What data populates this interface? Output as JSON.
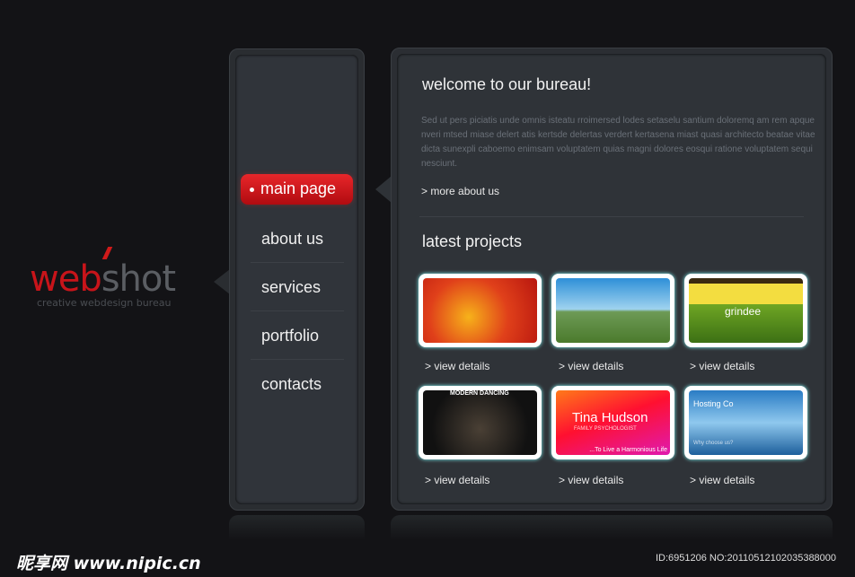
{
  "logo": {
    "part1": "web",
    "part2": "shot",
    "tagline": "creative webdesign bureau"
  },
  "nav": {
    "items": [
      {
        "label": "main page",
        "active": true
      },
      {
        "label": "about us"
      },
      {
        "label": "services"
      },
      {
        "label": "portfolio"
      },
      {
        "label": "contacts"
      }
    ]
  },
  "welcome": {
    "title": "welcome to our bureau!",
    "text": "Sed ut pers piciatis unde omnis isteatu rroimersed lodes setaselu santium doloremq am rem apque nveri mtsed miase delert atis kertsde delertas verdert kertasena miast quasi architecto  beatae vitae dicta sunexpli caboemo enimsam voluptatem quias magni dolores eosqui ratione voluptatem sequi nesciunt.",
    "more": ">  more about us"
  },
  "projects": {
    "title": "latest projects",
    "link": "> view details",
    "items": [
      {
        "image": "christmas-ornaments"
      },
      {
        "image": "beach-landscape"
      },
      {
        "image": "grindee-site",
        "text": "grindee"
      },
      {
        "image": "dancing-site",
        "text": "MODERN DANCING"
      },
      {
        "image": "psychologist-site",
        "text": "Tina Hudson",
        "sub": "FAMILY PSYCHOLOGIST",
        "tagline": "...To Live a Harmonious Life"
      },
      {
        "image": "hosting-site",
        "text": "Hosting Co",
        "sub": "Why choose us?"
      }
    ]
  },
  "watermark": {
    "site": "昵享网 www.nipic.cn",
    "id": "ID:6951206 NO:20110512102035388000"
  },
  "colors": {
    "accent": "#d01a1a",
    "background": "#131316",
    "panel": "#2f3338"
  }
}
